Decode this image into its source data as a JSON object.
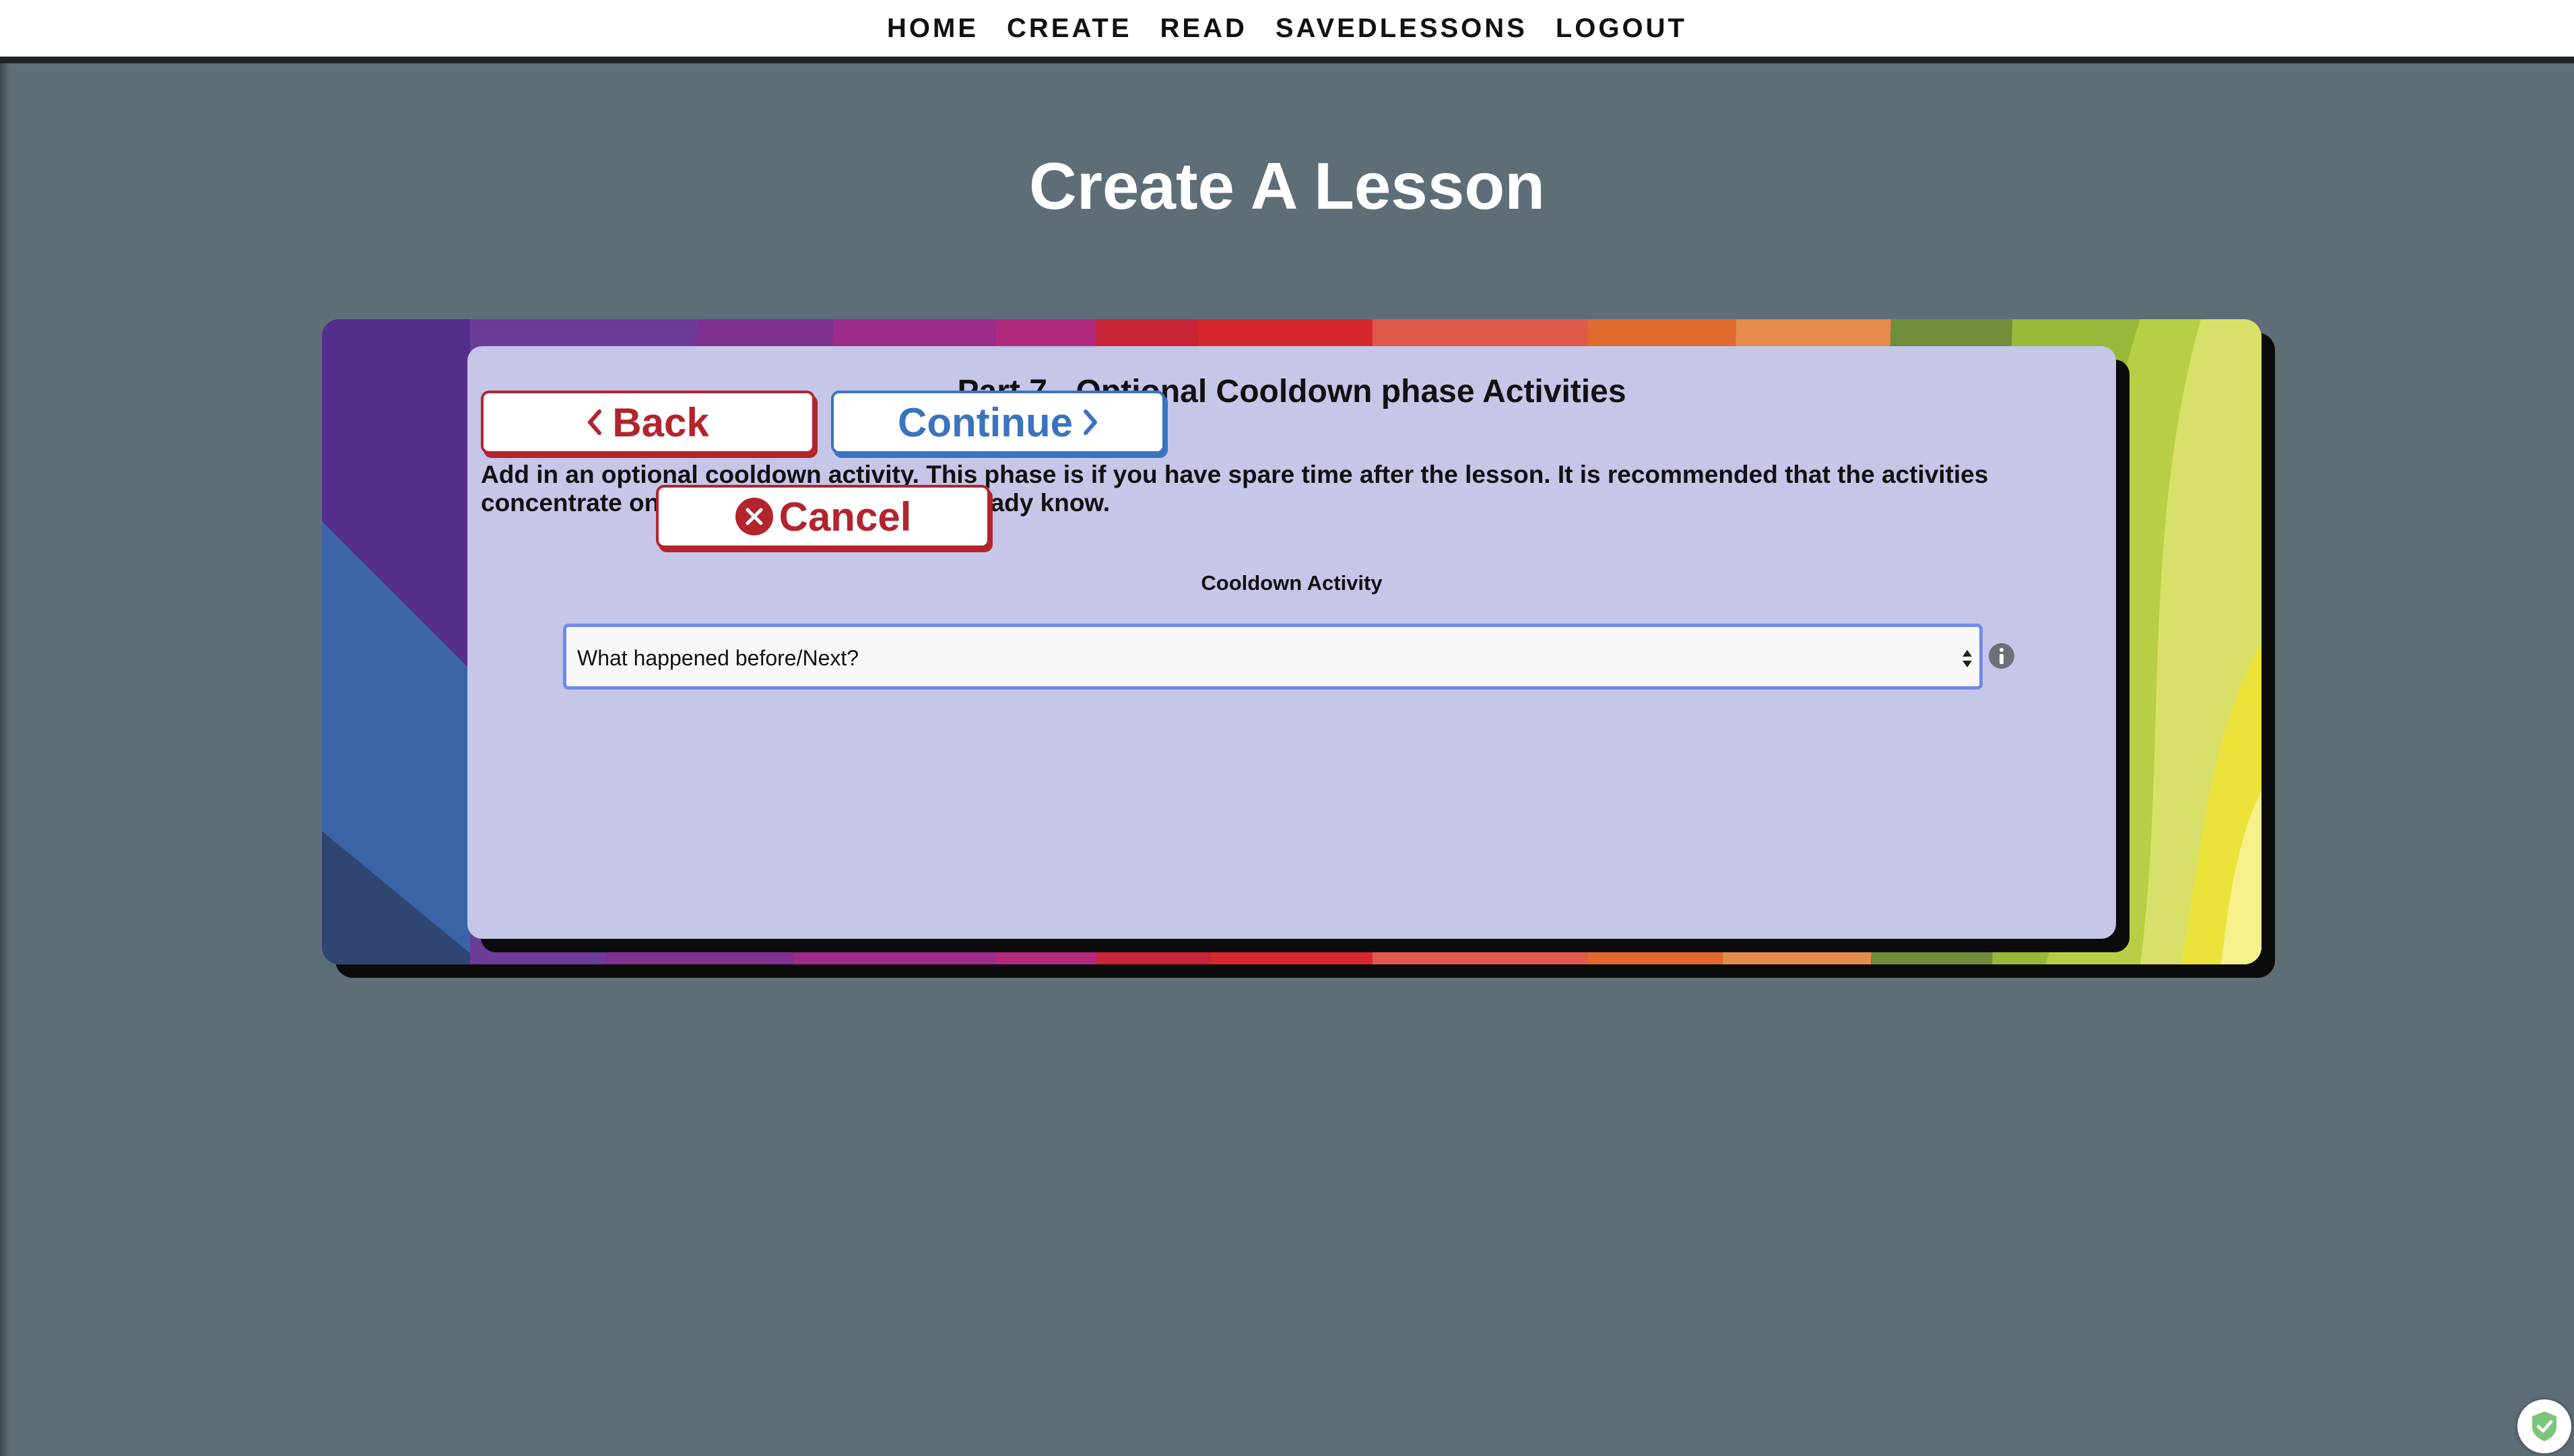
{
  "nav": {
    "items": [
      {
        "label": "HOME"
      },
      {
        "label": "CREATE"
      },
      {
        "label": "READ"
      },
      {
        "label": "SAVEDLESSONS"
      },
      {
        "label": "LOGOUT"
      }
    ]
  },
  "page": {
    "title": "Create A Lesson"
  },
  "card": {
    "title": "Part 7 - Optional Cooldown phase Activities",
    "description": "Add in an optional cooldown activity. This phase is if you have spare time after the lesson. It is recommended that the activities concentrate on items that the students already know.",
    "field_label": "Cooldown Activity",
    "select_value": "What happened before/Next?"
  },
  "buttons": {
    "back": "Back",
    "continue": "Continue",
    "cancel": "Cancel"
  },
  "icons": {
    "select": "select-arrows-icon",
    "info": "info-icon",
    "back": "chevron-left-icon",
    "continue": "chevron-right-icon",
    "cancel": "close-circle-icon",
    "badge": "shield-check-icon"
  },
  "colors": {
    "background": "#5e6e79",
    "card": "#c5c6e8",
    "danger": "#b3242c",
    "primary": "#3a73bf",
    "select_border": "#6f8be8"
  }
}
